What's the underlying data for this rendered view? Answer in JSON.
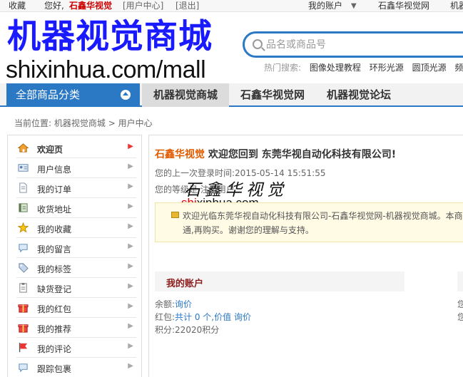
{
  "topbar": {
    "favorite": "收藏",
    "hello": "您好,",
    "username": "石鑫华视觉",
    "user_center": "[用户中心]",
    "logout": "[退出]",
    "my_account": "我的账户",
    "site1": "石鑫华视觉网",
    "site2": "机器"
  },
  "logo": {
    "cn": "机器视觉商城",
    "en": "shixinhua.com/mall"
  },
  "search": {
    "placeholder": "品名或商品号",
    "hot_label": "热门搜索:",
    "hot_words": [
      "图像处理教程",
      "环形光源",
      "圆顶光源",
      "频"
    ]
  },
  "nav": {
    "all_categories": "全部商品分类",
    "tabs": [
      "机器视觉商城",
      "石鑫华视觉网",
      "机器视觉论坛"
    ]
  },
  "breadcrumb": {
    "label": "当前位置:",
    "mall": "机器视觉商城",
    "sep": ">",
    "current": "用户中心"
  },
  "sidebar": {
    "items": [
      {
        "label": "欢迎页",
        "icon": "home-icon"
      },
      {
        "label": "用户信息",
        "icon": "id-card-icon"
      },
      {
        "label": "我的订单",
        "icon": "document-icon"
      },
      {
        "label": "收货地址",
        "icon": "address-book-icon"
      },
      {
        "label": "我的收藏",
        "icon": "star-icon"
      },
      {
        "label": "我的留言",
        "icon": "speech-bubble-icon"
      },
      {
        "label": "我的标签",
        "icon": "tag-icon"
      },
      {
        "label": "缺货登记",
        "icon": "clipboard-icon"
      },
      {
        "label": "我的红包",
        "icon": "gift-icon"
      },
      {
        "label": "我的推荐",
        "icon": "gift-icon"
      },
      {
        "label": "我的评论",
        "icon": "flag-icon"
      },
      {
        "label": "跟踪包裹",
        "icon": "speech-bubble-icon"
      }
    ]
  },
  "main": {
    "welcome_user": "石鑫华视觉",
    "welcome_msg": "欢迎您回到 东莞华视自动化科技有限公司!",
    "last_login": "您的上一次登录时间:2015-05-14 15:51:55",
    "level": "您的等级是 注册用户",
    "notice": "欢迎光临东莞华视自动化科技有限公司-石鑫华视觉网-机器视觉商城。本商服沟通,再购买。谢谢您的理解与支持。",
    "account_title": "我的账户",
    "balance_label": "余额:",
    "balance_link": "询价",
    "redpack_label": "红包:",
    "redpack_link": "共计 0 个,价值 询价",
    "points_label": "积分:",
    "points_value": "22020积分",
    "right_glyph1": "您",
    "right_glyph2": "您"
  },
  "watermark": {
    "cn": "石鑫华视觉",
    "url_red": "shi",
    "url_rest": "xinhua.com"
  },
  "colors": {
    "brand_blue": "#2b78c5",
    "logo_blue": "#1a1aff",
    "accent_red": "#c00",
    "welcome_orange": "#e05b00"
  }
}
